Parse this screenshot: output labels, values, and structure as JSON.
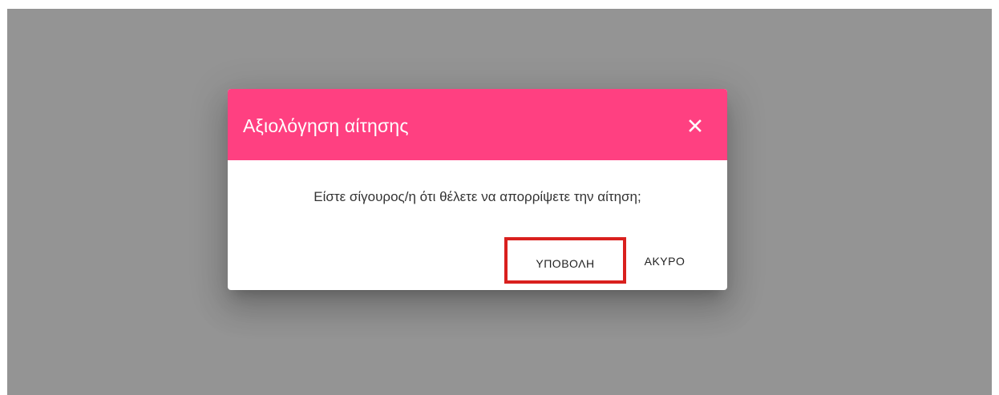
{
  "dialog": {
    "title": "Αξιολόγηση αίτησης",
    "close_icon": "close-icon",
    "message": "Είστε σίγουρος/η ότι θέλετε να απορρίψετε την αίτηση;",
    "submit_label": "ΥΠΟΒΟΛΗ",
    "cancel_label": "ΑΚΥΡΟ"
  },
  "colors": {
    "overlay": "#949494",
    "header": "#ff4081",
    "highlight_border": "#d9201e"
  }
}
